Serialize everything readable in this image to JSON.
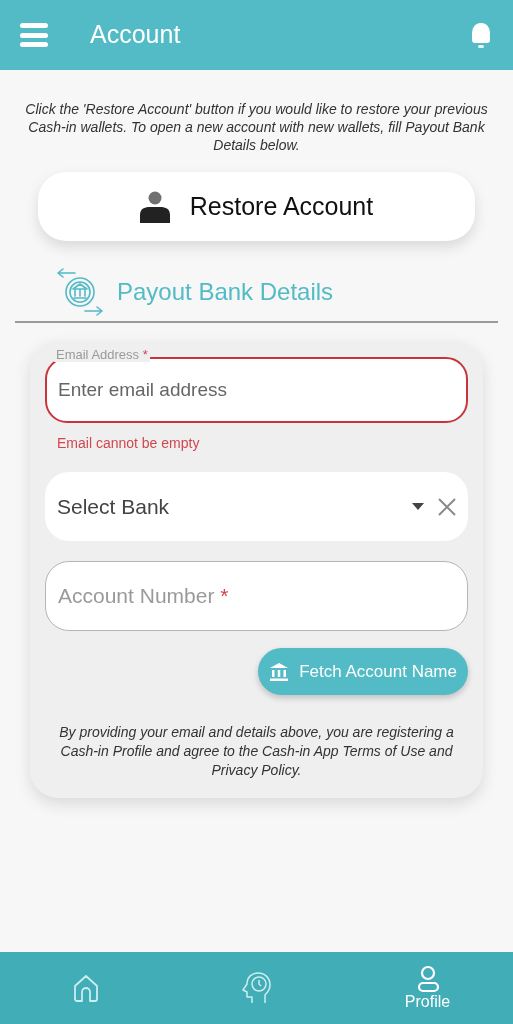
{
  "header": {
    "title": "Account"
  },
  "intro": "Click the 'Restore Account' button if you would like to restore your previous Cash-in wallets. To open a new account with new wallets, fill Payout Bank Details below.",
  "restore_button": {
    "label": "Restore Account"
  },
  "section": {
    "title": "Payout Bank Details"
  },
  "form": {
    "email": {
      "label": "Email Address",
      "required_mark": "*",
      "placeholder": "Enter email address",
      "error": true,
      "error_text": "Email cannot be empty"
    },
    "bank_select": {
      "placeholder": "Select Bank"
    },
    "account_number": {
      "placeholder": "Account Number",
      "required_mark": "*"
    },
    "fetch_button": {
      "label": "Fetch Account Name"
    },
    "disclaimer": "By providing your email and details above, you are registering a Cash-in Profile and agree to the Cash-in App Terms of Use and Privacy Policy."
  },
  "bottom_nav": [
    {
      "kind": "home",
      "selected": false
    },
    {
      "kind": "history",
      "selected": false
    },
    {
      "kind": "profile",
      "label": "Profile",
      "selected": true
    }
  ]
}
